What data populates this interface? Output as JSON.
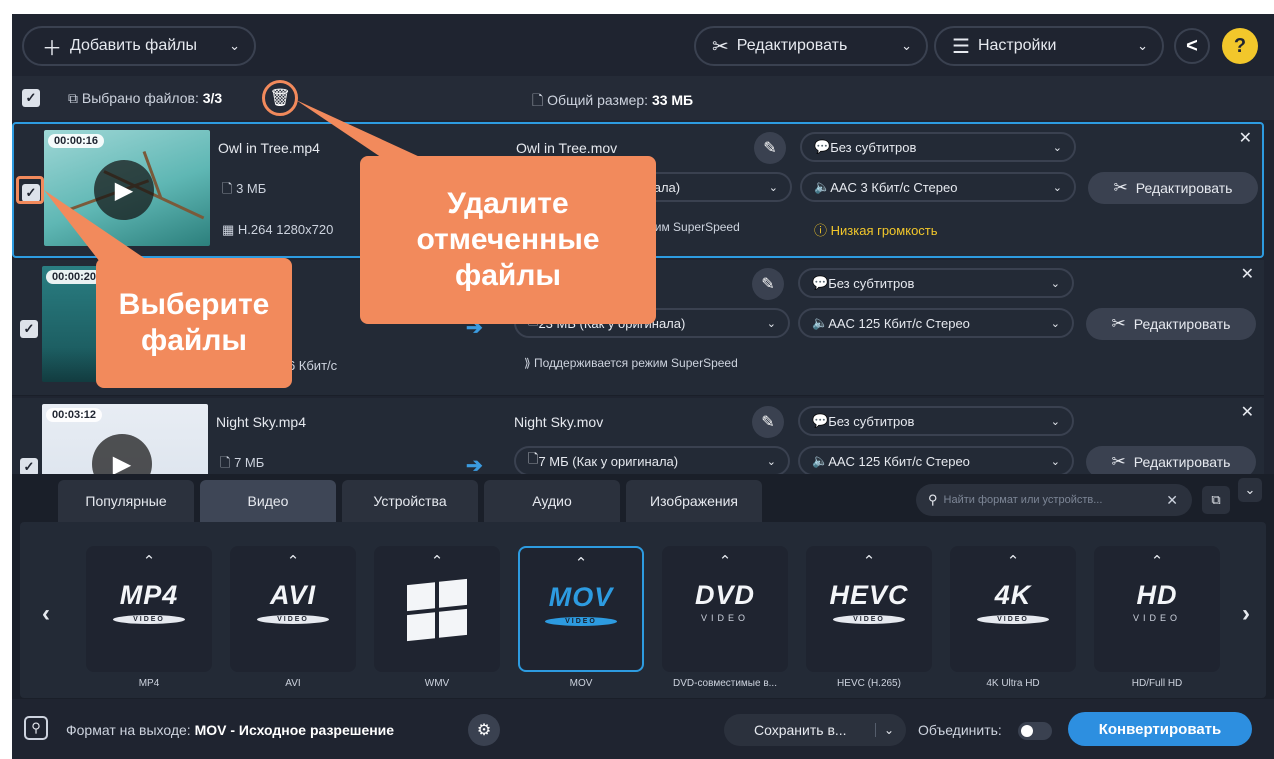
{
  "toolbar": {
    "add_files": "Добавить файлы",
    "edit": "Редактировать",
    "settings": "Настройки",
    "help": "?"
  },
  "selection": {
    "selected_label": "Выбрано файлов:",
    "selected_value": "3/3",
    "total_label": "Общий размер:",
    "total_value": "33 МБ"
  },
  "files": [
    {
      "duration": "00:00:16",
      "source_name": "Owl in Tree.mp4",
      "source_size": "3 МБ",
      "source_codec": "H.264 1280x720",
      "output_name": "Owl in Tree.mov",
      "output_size": "3 МБ (Как у оригинала)",
      "subtitles": "Без субтитров",
      "audio": "AAC 3 Кбит/с Стерео",
      "superspeed": "Поддерживается режим SuperSpeed",
      "warning": "Низкая громкость",
      "edit_label": "Редактировать"
    },
    {
      "duration": "00:00:20",
      "source_name": "",
      "source_size": "",
      "source_codec": "854x480 766 Кбит/с",
      "output_name": "",
      "output_size": "23 МБ (Как у оригинала)",
      "subtitles": "Без субтитров",
      "audio": "AAC 125 Кбит/с Стерео",
      "superspeed": "Поддерживается режим SuperSpeed",
      "warning": "",
      "edit_label": "Редактировать"
    },
    {
      "duration": "00:03:12",
      "source_name": "Night Sky.mp4",
      "source_size": "7 МБ",
      "source_codec": "",
      "output_name": "Night Sky.mov",
      "output_size": "7 МБ (Как у оригинала)",
      "subtitles": "Без субтитров",
      "audio": "AAC 125 Кбит/с Стерео",
      "superspeed": "",
      "warning": "",
      "edit_label": "Редактировать"
    }
  ],
  "tabs": [
    {
      "label": "Популярные"
    },
    {
      "label": "Видео"
    },
    {
      "label": "Устройства"
    },
    {
      "label": "Аудио"
    },
    {
      "label": "Изображения"
    }
  ],
  "search": {
    "placeholder": "Найти формат или устройств..."
  },
  "formats": [
    {
      "logo": "MP4",
      "disc": "VIDEO",
      "label": "MP4"
    },
    {
      "logo": "AVI",
      "disc": "VIDEO",
      "label": "AVI"
    },
    {
      "logo": "",
      "disc": "",
      "label": "WMV"
    },
    {
      "logo": "MOV",
      "disc": "VIDEO",
      "label": "MOV"
    },
    {
      "logo": "DVD",
      "disc": "VIDEO",
      "label": "DVD-совместимые в..."
    },
    {
      "logo": "HEVC",
      "disc": "VIDEO",
      "label": "HEVC (H.265)"
    },
    {
      "logo": "4K",
      "disc": "VIDEO",
      "label": "4K Ultra HD"
    },
    {
      "logo": "HD",
      "disc": "VIDEO",
      "label": "HD/Full HD"
    }
  ],
  "footer": {
    "output_label": "Формат на выходе:",
    "output_value": "MOV - Исходное разрешение",
    "save_to": "Сохранить в...",
    "merge": "Объединить:",
    "convert": "Конвертировать"
  },
  "callouts": {
    "delete": [
      "Удалите",
      "отмеченные",
      "файлы"
    ],
    "select": [
      "Выберите",
      "файлы"
    ]
  },
  "colors": {
    "accent": "#2d8fe0",
    "callout": "#f28a5c",
    "warning": "#f2c72b",
    "background": "#1f2430"
  }
}
